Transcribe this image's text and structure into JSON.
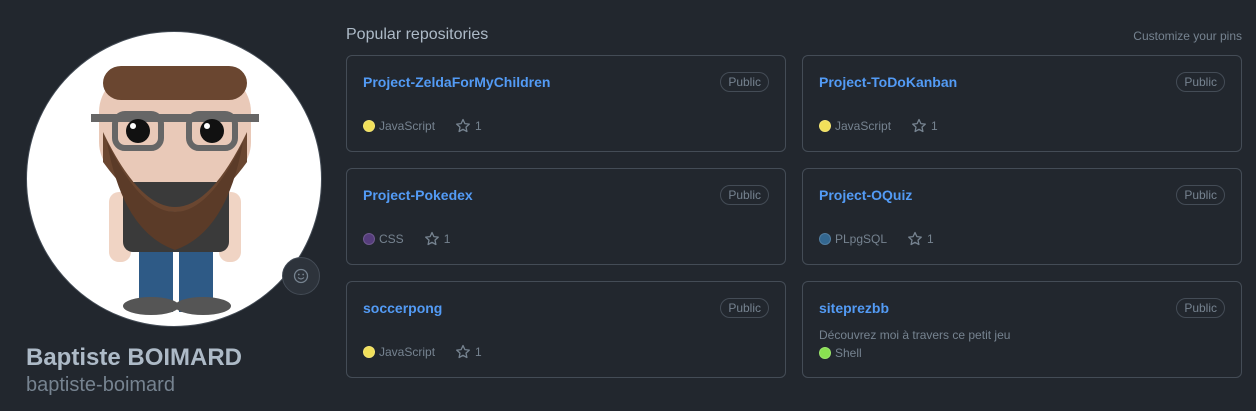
{
  "profile": {
    "fullname": "Baptiste BOIMARD",
    "username": "baptiste-boimard"
  },
  "section": {
    "title": "Popular repositories",
    "customize_label": "Customize your pins"
  },
  "repos": [
    {
      "name": "Project-ZeldaForMyChildren",
      "visibility": "Public",
      "description": "",
      "language": "JavaScript",
      "lang_color": "#f1e05a",
      "stars": "1"
    },
    {
      "name": "Project-ToDoKanban",
      "visibility": "Public",
      "description": "",
      "language": "JavaScript",
      "lang_color": "#f1e05a",
      "stars": "1"
    },
    {
      "name": "Project-Pokedex",
      "visibility": "Public",
      "description": "",
      "language": "CSS",
      "lang_color": "#563d7c",
      "stars": "1"
    },
    {
      "name": "Project-OQuiz",
      "visibility": "Public",
      "description": "",
      "language": "PLpgSQL",
      "lang_color": "#336790",
      "stars": "1"
    },
    {
      "name": "soccerpong",
      "visibility": "Public",
      "description": "",
      "language": "JavaScript",
      "lang_color": "#f1e05a",
      "stars": "1"
    },
    {
      "name": "siteprezbb",
      "visibility": "Public",
      "description": "Découvrez moi à travers ce petit jeu",
      "language": "Shell",
      "lang_color": "#89e051",
      "stars": ""
    }
  ],
  "colors": {
    "background": "#22272e",
    "link": "#539bf5",
    "border": "#444c56",
    "muted": "#768390"
  }
}
